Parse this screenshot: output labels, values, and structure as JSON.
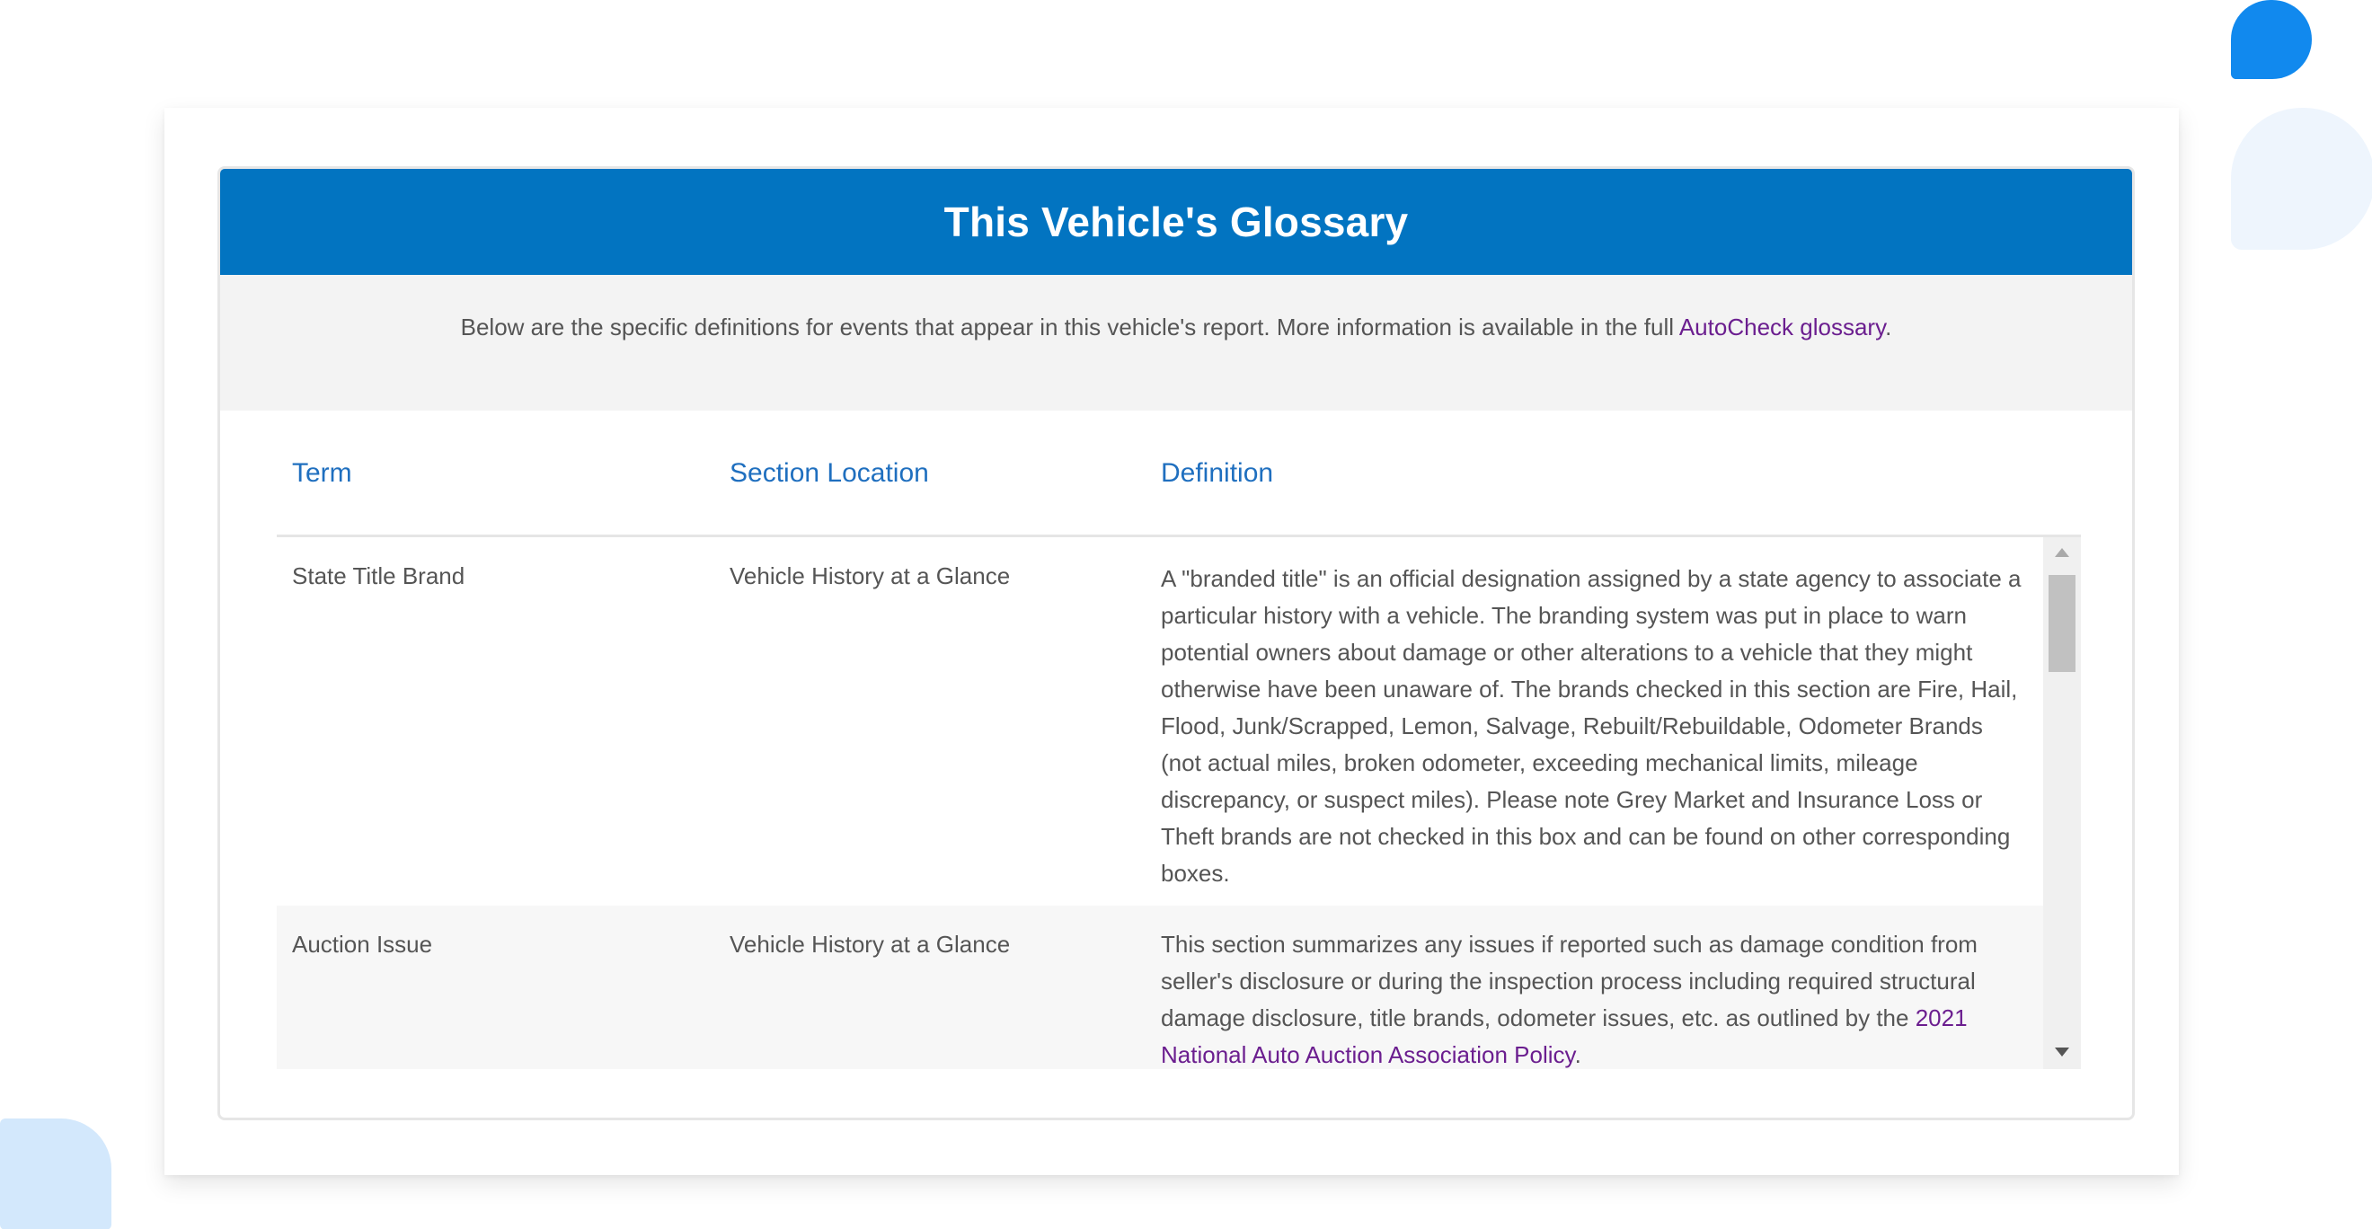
{
  "glossary": {
    "title": "This Vehicle's Glossary",
    "intro_text": "Below are the specific definitions for events that appear in this vehicle's report. More information is available in the full ",
    "intro_link": "AutoCheck glossary",
    "intro_end": "."
  },
  "table": {
    "headers": {
      "term": "Term",
      "section": "Section Location",
      "definition": "Definition"
    },
    "rows": [
      {
        "term": "State Title Brand",
        "section": "Vehicle History at a Glance",
        "definition": "A \"branded title\" is an official designation assigned by a state agency to associate a particular history with a vehicle. The branding system was put in place to warn potential owners about damage or other alterations to a vehicle that they might otherwise have been unaware of. The brands checked in this section are Fire, Hail, Flood, Junk/Scrapped, Lemon, Salvage, Rebuilt/Rebuildable, Odometer Brands (not actual miles, broken odometer, exceeding mechanical limits, mileage discrepancy, or suspect miles). Please note Grey Market and Insurance Loss or Theft brands are not checked in this box and can be found on other corresponding boxes."
      },
      {
        "term": "Auction Issue",
        "section": "Vehicle History at a Glance",
        "definition": "This section summarizes any issues if reported such as damage condition from seller's disclosure or during the inspection process including required structural damage disclosure, title brands, odometer issues, etc. as outlined by the ",
        "definition_link": "2021 National Auto Auction Association Policy",
        "definition_end": "."
      }
    ]
  },
  "icons": {
    "scroll_up": "scroll-up-arrow-icon",
    "scroll_down": "scroll-down-arrow-icon"
  },
  "colors": {
    "header_bg": "#0274c1",
    "link": "#6b1e8f",
    "column_header": "#1f6fbf"
  }
}
